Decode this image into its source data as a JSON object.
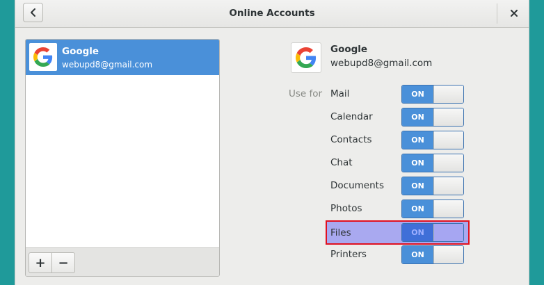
{
  "header": {
    "title": "Online Accounts",
    "back_icon": "chevron-left-icon",
    "close_icon": "close-icon"
  },
  "accounts_list": {
    "items": [
      {
        "provider": "Google",
        "email": "webupd8@gmail.com",
        "selected": true,
        "icon": "google-icon"
      }
    ],
    "toolbar": {
      "add_label": "+",
      "remove_label": "−"
    }
  },
  "detail": {
    "provider": "Google",
    "email": "webupd8@gmail.com",
    "use_for_label": "Use for",
    "services": [
      {
        "label": "Mail",
        "state": "ON"
      },
      {
        "label": "Calendar",
        "state": "ON"
      },
      {
        "label": "Contacts",
        "state": "ON"
      },
      {
        "label": "Chat",
        "state": "ON"
      },
      {
        "label": "Documents",
        "state": "ON"
      },
      {
        "label": "Photos",
        "state": "ON"
      },
      {
        "label": "Files",
        "state": "ON",
        "highlighted": true
      },
      {
        "label": "Printers",
        "state": "ON"
      }
    ]
  },
  "colors": {
    "accent": "#4a90d9",
    "highlight_outline": "#e01020",
    "highlight_fill": "#a9a9f0"
  }
}
